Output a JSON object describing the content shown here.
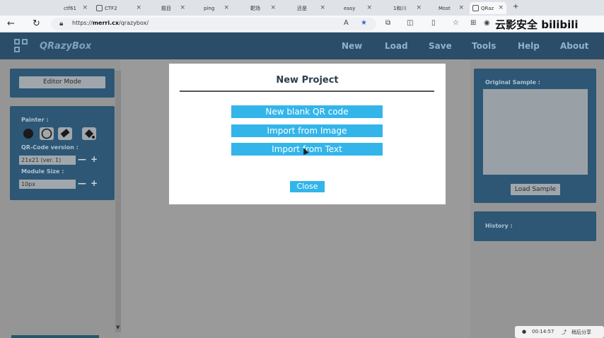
{
  "browser": {
    "tabs": [
      "ctf61",
      "CTF2",
      "题目",
      "ping",
      "靶场",
      "还是",
      "easy",
      "1和川",
      "Most",
      "QRaz"
    ],
    "url_prefix": "https://",
    "url_host": "merri.cx",
    "url_path": "/qrazybox/",
    "read_aloud": "A",
    "watermark": "云影安全 bilibili"
  },
  "app": {
    "brand": "QRazyBox",
    "menu": [
      "New",
      "Load",
      "Save",
      "Tools",
      "Help",
      "About"
    ]
  },
  "left_panel": {
    "editor_mode": "Editor Mode",
    "painter_label": "Painter :",
    "version_label": "QR-Code version :",
    "version_value": "21x21 (ver. 1)",
    "module_label": "Module Size :",
    "module_value": "10px",
    "minus": "—",
    "plus": "+"
  },
  "right_panel": {
    "original_sample": "Original Sample :",
    "load_sample": "Load Sample",
    "history": "History :"
  },
  "modal": {
    "title": "New Project",
    "new_blank": "New blank QR code",
    "import_image": "Import from Image",
    "import_text": "Import from Text",
    "close": "Close"
  },
  "video": {
    "time": "00:14:57",
    "share": "稍后分享"
  },
  "colors": {
    "navbar": "#2b4d67",
    "panel": "#2d5775",
    "modal_button": "#33b5ea"
  }
}
